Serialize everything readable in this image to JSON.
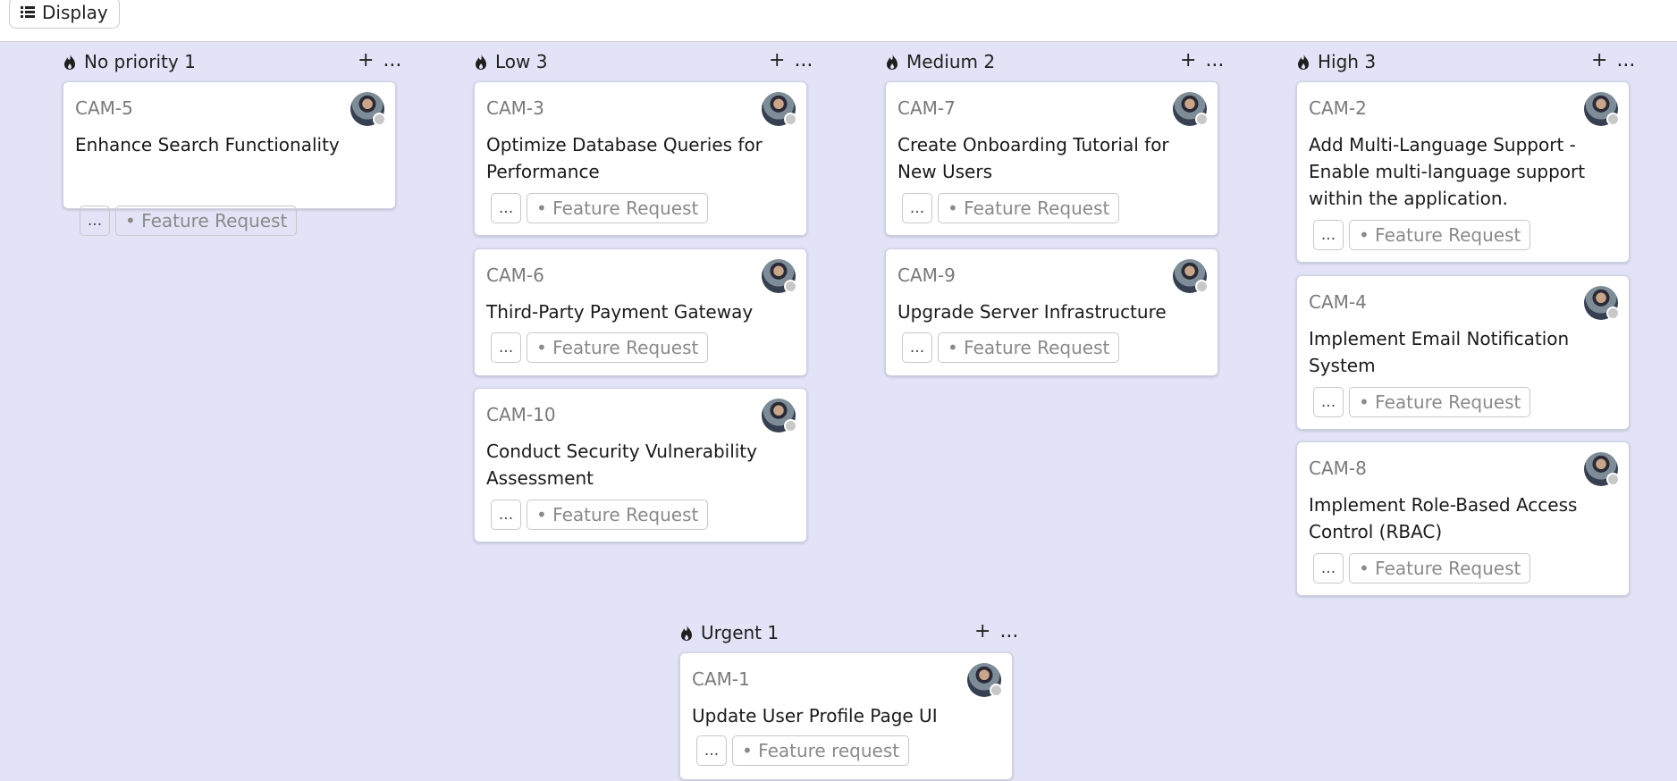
{
  "toolbar": {
    "display_label": "Display"
  },
  "columns": [
    {
      "id": "no-priority",
      "label": "No priority",
      "count": "1"
    },
    {
      "id": "low",
      "label": "Low",
      "count": "3"
    },
    {
      "id": "medium",
      "label": "Medium",
      "count": "2"
    },
    {
      "id": "high",
      "label": "High",
      "count": "3"
    },
    {
      "id": "urgent",
      "label": "Urgent",
      "count": "1"
    }
  ],
  "column_actions": {
    "add": "+",
    "more": "..."
  },
  "tag_more": "...",
  "cards": [
    {
      "id": "CAM-5",
      "title": "Enhance Search Functionality",
      "tag": "• Feature Request"
    },
    {
      "id": "CAM-3",
      "title": "Optimize Database Queries for Performance",
      "tag": "• Feature Request"
    },
    {
      "id": "CAM-6",
      "title": "Third-Party Payment Gateway",
      "tag": "• Feature Request"
    },
    {
      "id": "CAM-10",
      "title": "Conduct Security Vulnerability Assessment",
      "tag": "• Feature Request"
    },
    {
      "id": "CAM-7",
      "title": "Create Onboarding Tutorial for New Users",
      "tag": "• Feature Request"
    },
    {
      "id": "CAM-9",
      "title": "Upgrade Server Infrastructure",
      "tag": "• Feature Request"
    },
    {
      "id": "CAM-2",
      "title": "Add Multi-Language Support - Enable multi-language support within the application.",
      "tag": "• Feature Request"
    },
    {
      "id": "CAM-4",
      "title": "Implement Email Notification System",
      "tag": "• Feature Request"
    },
    {
      "id": "CAM-8",
      "title": "Implement Role-Based Access Control (RBAC)",
      "tag": "• Feature Request"
    },
    {
      "id": "CAM-1",
      "title": "Update User Profile Page UI",
      "tag": "• Feature request"
    }
  ],
  "colors": {
    "board_bg": "#e3e3f7",
    "card_bg": "#ffffff",
    "muted_text": "#7a7a7a"
  },
  "icons": {
    "column": "flame-icon",
    "display": "list-icon",
    "avatar": "user-avatar"
  }
}
